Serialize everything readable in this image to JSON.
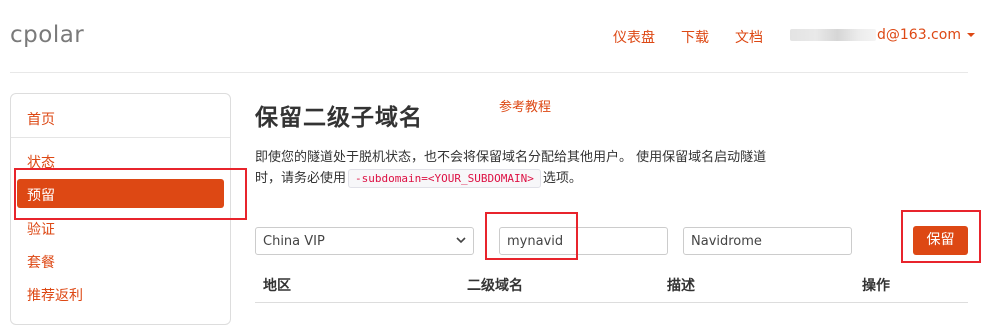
{
  "header": {
    "brand": "cpolar",
    "nav": {
      "dashboard": "仪表盘",
      "download": "下载",
      "docs": "文档"
    },
    "user_email_visible": "d@163.com"
  },
  "sidebar": {
    "items": [
      {
        "label": "首页"
      },
      {
        "label": "状态"
      },
      {
        "label": "预留",
        "active": true
      },
      {
        "label": "验证"
      },
      {
        "label": "套餐"
      },
      {
        "label": "推荐返利"
      }
    ]
  },
  "main": {
    "title": "保留二级子域名",
    "reference_link": "参考教程",
    "description_part1": "即使您的隧道处于脱机状态，也不会将保留域名分配给其他用户。 使用保留域名启动隧道",
    "description_part2_prefix": "时，请务必使用",
    "description_code": "-subdomain=<YOUR_SUBDOMAIN>",
    "description_part2_suffix": "选项。"
  },
  "form": {
    "region_selected": "China VIP",
    "subdomain_value": "mynavid",
    "description_value": "Navidrome",
    "save_label": "保留"
  },
  "table": {
    "columns": [
      "地区",
      "二级域名",
      "描述",
      "操作"
    ]
  },
  "colors": {
    "accent": "#dd4814",
    "highlight_box": "#e8242c"
  }
}
